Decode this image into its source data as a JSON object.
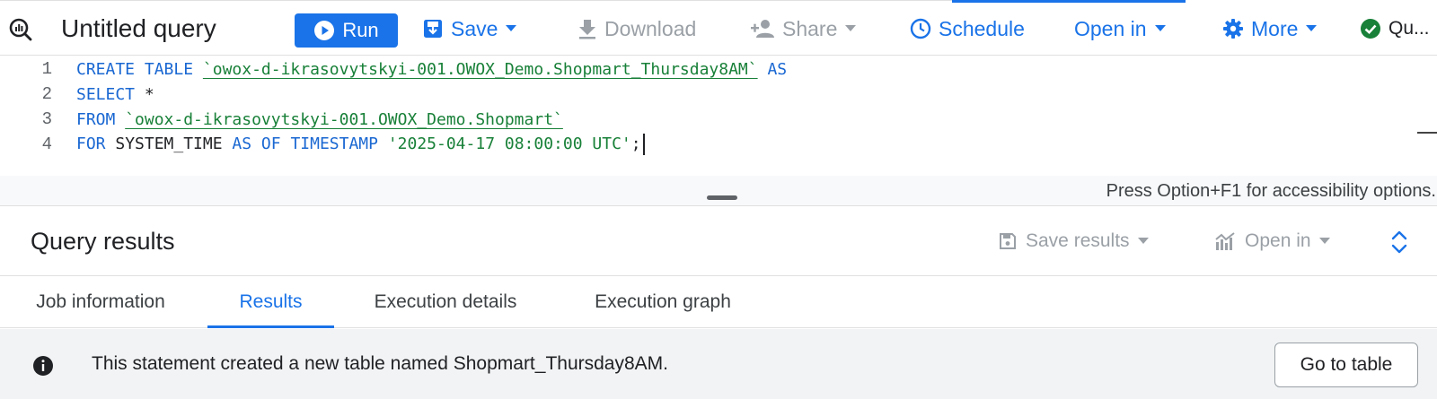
{
  "toolbar": {
    "title": "Untitled query",
    "run_label": "Run",
    "save_label": "Save",
    "download_label": "Download",
    "share_label": "Share",
    "schedule_label": "Schedule",
    "open_in_label": "Open in",
    "more_label": "More",
    "status_label": "Qu..."
  },
  "editor": {
    "line_numbers": [
      "1",
      "2",
      "3",
      "4"
    ],
    "line1": {
      "kw1": "CREATE TABLE",
      "table": "`owox-d-ikrasovytskyi-001.OWOX_Demo.Shopmart_Thursday8AM`",
      "kw2": "AS"
    },
    "line2": {
      "kw1": "SELECT",
      "star": "*"
    },
    "line3": {
      "kw1": "FROM",
      "table": "`owox-d-ikrasovytskyi-001.OWOX_Demo.Shopmart`"
    },
    "line4": {
      "kw1": "FOR",
      "id1": "SYSTEM_TIME",
      "kw2": "AS OF TIMESTAMP",
      "literal": "'2025-04-17 08:00:00 UTC'",
      "terminator": ";"
    },
    "accessibility_hint": "Press Option+F1 for accessibility options."
  },
  "results": {
    "title": "Query results",
    "save_results_label": "Save results",
    "open_in_label": "Open in"
  },
  "tabs": [
    {
      "label": "Job information",
      "active": false
    },
    {
      "label": "Results",
      "active": true
    },
    {
      "label": "Execution details",
      "active": false
    },
    {
      "label": "Execution graph",
      "active": false
    }
  ],
  "banner": {
    "message": "This statement created a new table named Shopmart_Thursday8AM.",
    "button_label": "Go to table"
  },
  "colors": {
    "accent": "#1a73e8",
    "keyword": "#1967d2",
    "string": "#188038",
    "disabled": "#9aa0a6",
    "success": "#188038"
  },
  "icons": {
    "query": "query-icon",
    "run": "play-circle-icon",
    "save": "save-icon",
    "download": "download-icon",
    "share": "person-add-icon",
    "schedule": "clock-icon",
    "more": "gear-icon",
    "status": "check-circle-icon",
    "info": "info-icon",
    "expand": "unfold-icon"
  }
}
